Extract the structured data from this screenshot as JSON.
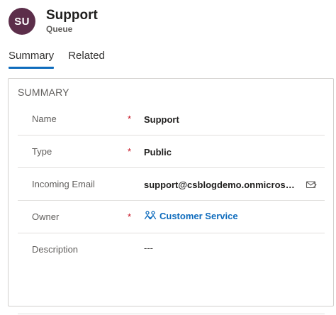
{
  "record": {
    "avatar_initials": "SU",
    "title": "Support",
    "entity": "Queue"
  },
  "tabs": [
    {
      "label": "Summary",
      "active": true
    },
    {
      "label": "Related",
      "active": false
    }
  ],
  "summary": {
    "section_title": "SUMMARY",
    "fields": {
      "name": {
        "label": "Name",
        "required_mark": "*",
        "value": "Support"
      },
      "type": {
        "label": "Type",
        "required_mark": "*",
        "value": "Public"
      },
      "incoming_email": {
        "label": "Incoming Email",
        "value": "support@csblogdemo.onmicrosoft.com",
        "icon": "email-send-icon"
      },
      "owner": {
        "label": "Owner",
        "required_mark": "*",
        "value": "Customer Service",
        "icon": "team-icon"
      },
      "description": {
        "label": "Description",
        "value": "---"
      }
    }
  },
  "colors": {
    "avatar_bg": "#5c2e4a",
    "accent": "#0f6cbd",
    "required": "#c50f1f",
    "link": "#0f6cbd"
  }
}
